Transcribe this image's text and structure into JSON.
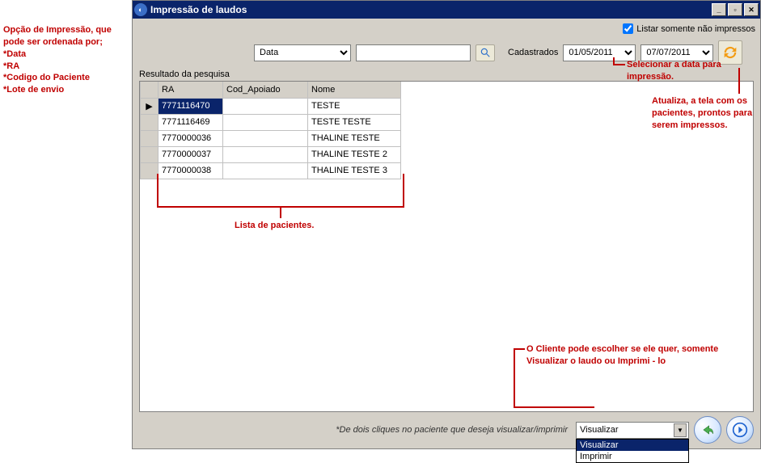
{
  "window": {
    "title": "Impressão de laudos"
  },
  "toolbar": {
    "list_only_unprinted_label": "Listar somente não impressos",
    "list_only_unprinted_checked": true,
    "sort_label_prefix": "Data",
    "sort_options": [
      "Data",
      "RA",
      "Codigo do Paciente",
      "Lote de envio"
    ],
    "search_value": "",
    "cadastrados_label": "Cadastrados",
    "date_from": "01/05/2011",
    "date_to": "07/07/2011"
  },
  "results_label": "Resultado da pesquisa",
  "grid": {
    "columns": {
      "ra": "RA",
      "cod": "Cod_Apoiado",
      "nome": "Nome"
    },
    "rows": [
      {
        "ra": "7771116470",
        "cod": "",
        "nome": "TESTE",
        "current": true
      },
      {
        "ra": "7771116469",
        "cod": "",
        "nome": "TESTE TESTE",
        "current": false
      },
      {
        "ra": "7770000036",
        "cod": "",
        "nome": "THALINE TESTE",
        "current": false
      },
      {
        "ra": "7770000037",
        "cod": "",
        "nome": "THALINE TESTE 2",
        "current": false
      },
      {
        "ra": "7770000038",
        "cod": "",
        "nome": "THALINE TESTE 3",
        "current": false
      }
    ]
  },
  "footer": {
    "hint": "*De dois cliques no paciente que deseja visualizar/imprimir",
    "action_selected": "Visualizar",
    "action_options": [
      "Visualizar",
      "Imprimir"
    ]
  },
  "annotations": {
    "sort_hint": "Opção de Impressão, que pode ser ordenada por;",
    "sort_list": [
      "*Data",
      "*RA",
      "*Codigo do Paciente",
      "*Lote de envio"
    ],
    "date_hint": "Selecionar a data para impressão.",
    "refresh_hint": "Atualiza, a tela com os pacientes, prontos para serem impressos.",
    "list_hint": "Lista de pacientes.",
    "action_hint": "O Cliente pode escolher se ele quer, somente Visualizar o  laudo ou Imprimi - lo"
  }
}
